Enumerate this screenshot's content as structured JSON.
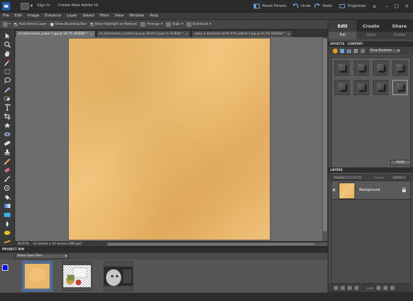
{
  "titlebar": {
    "sign_in": "Sign In",
    "create_id": "Create New Adobe ID",
    "reset_panels": "Reset Panels",
    "undo": "Undo",
    "redo": "Redo",
    "organizer": "Organizer"
  },
  "menu": [
    "File",
    "Edit",
    "Image",
    "Enhance",
    "Layer",
    "Select",
    "Filter",
    "View",
    "Window",
    "Help"
  ],
  "options": {
    "auto_select": "Auto Select Layer",
    "bounding_box": "Show Bounding Box",
    "highlight": "Show Highlight on Rollover",
    "arrange": "Arrange",
    "align": "Align",
    "distribute": "Distribute"
  },
  "tabs": [
    "cd_talemmowc_paper-7.jpg @ 18.7% (RGB/8) *",
    "cd_talemmowc_cluster3.png @ 28.4% (Layer 0, RGB/8) *",
    "emily in blackand white #19_edited-1.jpg @ 44.7% (RGB/8) *"
  ],
  "status": {
    "zoom": "18.67%",
    "doc_size": "12 inches x 12 inches (300 ppi)"
  },
  "project_bin": {
    "header": "PROJECT BIN",
    "show": "Show Open Files"
  },
  "right_panel": {
    "modes": [
      "Edit",
      "Create",
      "Share"
    ],
    "subtabs": [
      "Full",
      "Quick",
      "Guided"
    ],
    "effects_tab": "EFFECTS",
    "content_tab": "CONTENT",
    "effect_category": "Drop Shadows",
    "apply": "Apply",
    "layers_header": "LAYERS",
    "blend_mode": "Normal",
    "opacity_label": "Opacity:",
    "opacity": "100%",
    "layer_name": "Background",
    "lock_label": "Lock:"
  },
  "colors": {
    "foreground": "#0000ff",
    "background": "#ffffff",
    "accent": "#3b7ad8"
  }
}
